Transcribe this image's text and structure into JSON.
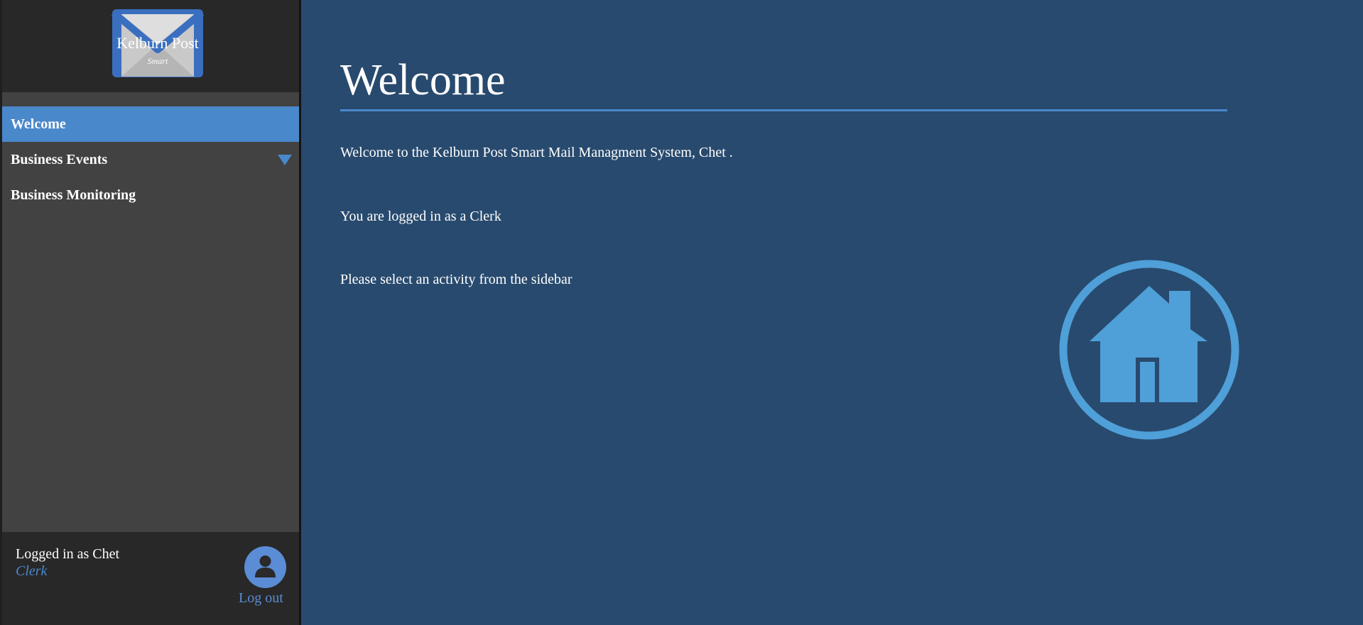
{
  "logo": {
    "title": "Kelburn Post",
    "subtitle": "Smart"
  },
  "nav": {
    "items": [
      {
        "label": "Welcome",
        "active": true
      },
      {
        "label": "Business Events",
        "has_dropdown": true
      },
      {
        "label": "Business Monitoring"
      }
    ]
  },
  "footer": {
    "logged_in_text": "Logged in as Chet",
    "role": "Clerk",
    "logout_label": "Log out"
  },
  "main": {
    "title": "Welcome",
    "paragraphs": [
      "Welcome to the Kelburn Post Smart Mail Managment System, Chet .",
      "You are logged in as a Clerk",
      "Please select an activity from the sidebar"
    ]
  },
  "icons": {
    "logo": "envelope-icon",
    "dropdown": "caret-down-icon",
    "avatar": "user-icon",
    "home": "home-icon"
  },
  "colors": {
    "accent": "#4a88cc",
    "main_background": "#284a6e",
    "sidebar_background": "#424242",
    "sidebar_header": "#282828",
    "home_icon": "#4f9fd8",
    "avatar": "#5b8cd6"
  }
}
